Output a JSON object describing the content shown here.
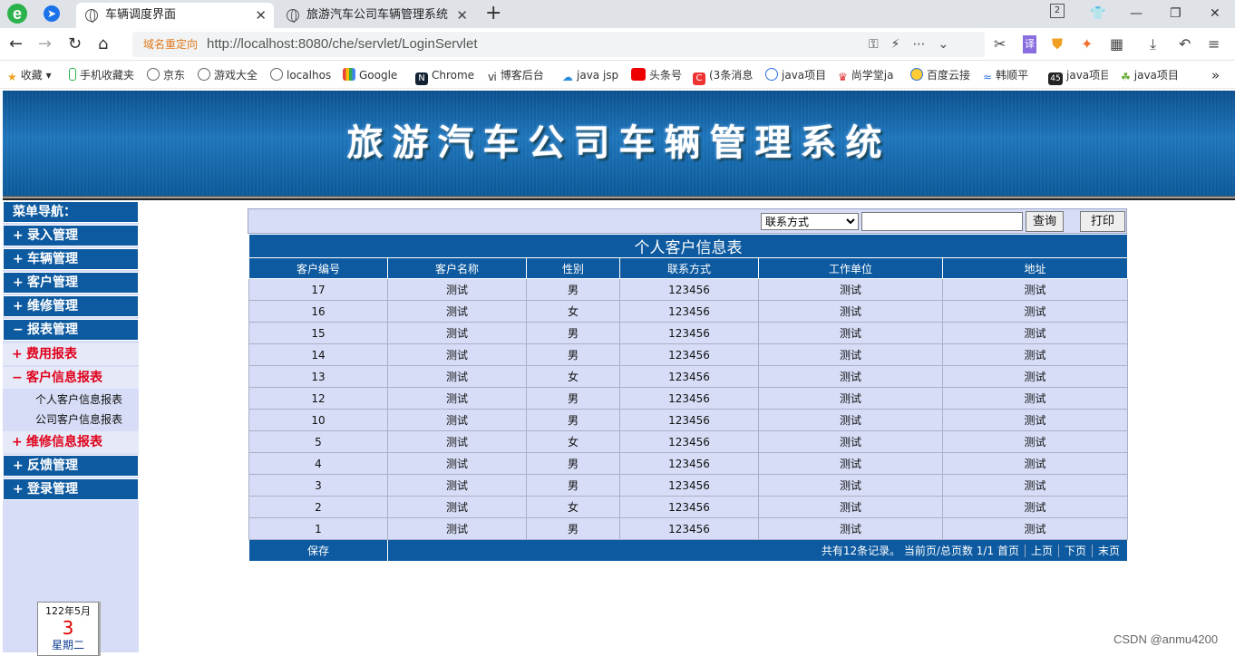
{
  "browser": {
    "tabs": [
      {
        "label": "车辆调度界面",
        "close": "✕"
      },
      {
        "label": "旅游汽车公司车辆管理系统",
        "close": "✕"
      }
    ],
    "tab_count": "2",
    "redirect_label": "域名重定向",
    "url": "http://localhost:8080/che/servlet/LoginServlet",
    "bookmarks": [
      "收藏",
      "手机收藏夹",
      "京东",
      "游戏大全",
      "localhos",
      "Google",
      "Chrome",
      "博客后台",
      "java jsp",
      "头条号",
      "(3条消息",
      "java项目",
      "尚学堂ja",
      "百度云接",
      "韩顺平",
      "java项目",
      "java项目"
    ],
    "more": "»"
  },
  "banner": {
    "title": "旅游汽车公司车辆管理系统"
  },
  "sidebar": {
    "header": "菜单导航：",
    "menu": [
      {
        "sym": "+",
        "label": "录入管理"
      },
      {
        "sym": "+",
        "label": "车辆管理"
      },
      {
        "sym": "+",
        "label": "客户管理"
      },
      {
        "sym": "+",
        "label": "维修管理"
      },
      {
        "sym": "−",
        "label": "报表管理"
      }
    ],
    "sub": [
      {
        "sym": "+",
        "label": "费用报表"
      },
      {
        "sym": "−",
        "label": "客户信息报表"
      }
    ],
    "leaves": [
      "个人客户信息报表",
      "公司客户信息报表"
    ],
    "sub_after": {
      "sym": "+",
      "label": "维修信息报表"
    },
    "menu_after": [
      {
        "sym": "+",
        "label": "反馈管理"
      },
      {
        "sym": "+",
        "label": "登录管理"
      }
    ],
    "calendar": {
      "year_month": "122年5月",
      "day": "3",
      "weekday": "星期二"
    }
  },
  "search": {
    "field_selected": "联系方式",
    "keyword": "",
    "query_label": "查询",
    "print_label": "打印"
  },
  "report": {
    "caption": "个人客户信息表",
    "columns": [
      "客户编号",
      "客户名称",
      "性别",
      "联系方式",
      "工作单位",
      "地址"
    ],
    "rows": [
      [
        "17",
        "测试",
        "男",
        "123456",
        "测试",
        "测试"
      ],
      [
        "16",
        "测试",
        "女",
        "123456",
        "测试",
        "测试"
      ],
      [
        "15",
        "测试",
        "男",
        "123456",
        "测试",
        "测试"
      ],
      [
        "14",
        "测试",
        "男",
        "123456",
        "测试",
        "测试"
      ],
      [
        "13",
        "测试",
        "女",
        "123456",
        "测试",
        "测试"
      ],
      [
        "12",
        "测试",
        "男",
        "123456",
        "测试",
        "测试"
      ],
      [
        "10",
        "测试",
        "男",
        "123456",
        "测试",
        "测试"
      ],
      [
        "5",
        "测试",
        "女",
        "123456",
        "测试",
        "测试"
      ],
      [
        "4",
        "测试",
        "男",
        "123456",
        "测试",
        "测试"
      ],
      [
        "3",
        "测试",
        "男",
        "123456",
        "测试",
        "测试"
      ],
      [
        "2",
        "测试",
        "女",
        "123456",
        "测试",
        "测试"
      ],
      [
        "1",
        "测试",
        "男",
        "123456",
        "测试",
        "测试"
      ]
    ],
    "save_label": "保存",
    "summary": "共有12条记录。 当前页/总页数 1/1",
    "first_page": "首页",
    "prev_page": "上页",
    "next_page": "下页",
    "last_page": "末页"
  },
  "watermark": "CSDN @anmu4200"
}
